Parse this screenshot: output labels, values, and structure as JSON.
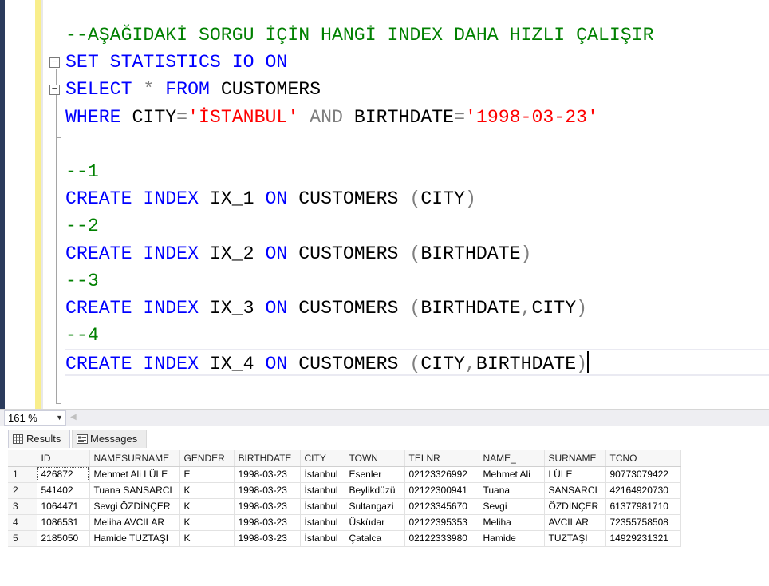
{
  "editor": {
    "lines": [
      [
        {
          "t": "--AŞAĞIDAKİ SORGU İÇİN HANGİ INDEX DAHA HIZLI ÇALIŞIR",
          "c": "cm"
        }
      ],
      [
        {
          "t": "SET STATISTICS IO ON",
          "c": "kw"
        }
      ],
      [
        {
          "t": "SELECT ",
          "c": "kw"
        },
        {
          "t": "* ",
          "c": "gr"
        },
        {
          "t": "FROM ",
          "c": "kw"
        },
        {
          "t": "CUSTOMERS",
          "c": "tx"
        }
      ],
      [
        {
          "t": "WHERE ",
          "c": "kw"
        },
        {
          "t": "CITY",
          "c": "tx"
        },
        {
          "t": "=",
          "c": "gr"
        },
        {
          "t": "'İSTANBUL'",
          "c": "str"
        },
        {
          "t": " AND ",
          "c": "gr"
        },
        {
          "t": "BIRTHDATE",
          "c": "tx"
        },
        {
          "t": "=",
          "c": "gr"
        },
        {
          "t": "'1998-03-23'",
          "c": "str"
        }
      ],
      [],
      [
        {
          "t": "--1",
          "c": "cm"
        }
      ],
      [
        {
          "t": "CREATE ",
          "c": "kw"
        },
        {
          "t": "INDEX ",
          "c": "kw"
        },
        {
          "t": "IX_1 ",
          "c": "tx"
        },
        {
          "t": "ON ",
          "c": "kw"
        },
        {
          "t": "CUSTOMERS ",
          "c": "tx"
        },
        {
          "t": "(",
          "c": "gr"
        },
        {
          "t": "CITY",
          "c": "tx"
        },
        {
          "t": ")",
          "c": "gr"
        }
      ],
      [
        {
          "t": "--2",
          "c": "cm"
        }
      ],
      [
        {
          "t": "CREATE ",
          "c": "kw"
        },
        {
          "t": "INDEX ",
          "c": "kw"
        },
        {
          "t": "IX_2 ",
          "c": "tx"
        },
        {
          "t": "ON ",
          "c": "kw"
        },
        {
          "t": "CUSTOMERS ",
          "c": "tx"
        },
        {
          "t": "(",
          "c": "gr"
        },
        {
          "t": "BIRTHDATE",
          "c": "tx"
        },
        {
          "t": ")",
          "c": "gr"
        }
      ],
      [
        {
          "t": "--3",
          "c": "cm"
        }
      ],
      [
        {
          "t": "CREATE ",
          "c": "kw"
        },
        {
          "t": "INDEX ",
          "c": "kw"
        },
        {
          "t": "IX_3 ",
          "c": "tx"
        },
        {
          "t": "ON ",
          "c": "kw"
        },
        {
          "t": "CUSTOMERS ",
          "c": "tx"
        },
        {
          "t": "(",
          "c": "gr"
        },
        {
          "t": "BIRTHDATE",
          "c": "tx"
        },
        {
          "t": ",",
          "c": "gr"
        },
        {
          "t": "CITY",
          "c": "tx"
        },
        {
          "t": ")",
          "c": "gr"
        }
      ],
      [
        {
          "t": "--4",
          "c": "cm"
        }
      ],
      [
        {
          "t": "CREATE ",
          "c": "kw"
        },
        {
          "t": "INDEX ",
          "c": "kw"
        },
        {
          "t": "IX_4 ",
          "c": "tx"
        },
        {
          "t": "ON ",
          "c": "kw"
        },
        {
          "t": "CUSTOMERS ",
          "c": "tx"
        },
        {
          "t": "(",
          "c": "gr"
        },
        {
          "t": "CITY",
          "c": "tx"
        },
        {
          "t": ",",
          "c": "gr"
        },
        {
          "t": "BIRTHDATE",
          "c": "tx"
        },
        {
          "t": ")",
          "c": "gr"
        }
      ]
    ],
    "fold_markers": [
      "minus",
      "minus"
    ],
    "colors": {
      "keyword": "#0000ff",
      "operator": "#7f7f7f",
      "string": "#ff0000",
      "comment": "#008000",
      "text": "#000000"
    }
  },
  "statusbar": {
    "zoom": "161 %",
    "zoom_arrow_icon": "chevron-down-icon",
    "scroll_left_icon": "scroll-left-arrow-icon"
  },
  "tabs": {
    "results": {
      "label": "Results",
      "icon": "grid-icon"
    },
    "messages": {
      "label": "Messages",
      "icon": "messages-icon"
    }
  },
  "grid": {
    "columns": [
      "ID",
      "NAMESURNAME",
      "GENDER",
      "BIRTHDATE",
      "CITY",
      "TOWN",
      "TELNR",
      "NAME_",
      "SURNAME",
      "TCNO"
    ],
    "rows": [
      [
        "1",
        "426872",
        "Mehmet Ali LÜLE",
        "E",
        "1998-03-23",
        "İstanbul",
        "Esenler",
        "02123326992",
        "Mehmet Ali",
        "LÜLE",
        "90773079422"
      ],
      [
        "2",
        "541402",
        "Tuana SANSARCI",
        "K",
        "1998-03-23",
        "İstanbul",
        "Beylikdüzü",
        "02122300941",
        "Tuana",
        "SANSARCI",
        "42164920730"
      ],
      [
        "3",
        "1064471",
        "Sevgi ÖZDİNÇER",
        "K",
        "1998-03-23",
        "İstanbul",
        "Sultangazi",
        "02123345670",
        "Sevgi",
        "ÖZDİNÇER",
        "61377981710"
      ],
      [
        "4",
        "1086531",
        "Meliha AVCILAR",
        "K",
        "1998-03-23",
        "İstanbul",
        "Üsküdar",
        "02122395353",
        "Meliha",
        "AVCILAR",
        "72355758508"
      ],
      [
        "5",
        "2185050",
        "Hamide TUZTAŞI",
        "K",
        "1998-03-23",
        "İstanbul",
        "Çatalca",
        "02122333980",
        "Hamide",
        "TUZTAŞI",
        "14929231321"
      ]
    ]
  }
}
